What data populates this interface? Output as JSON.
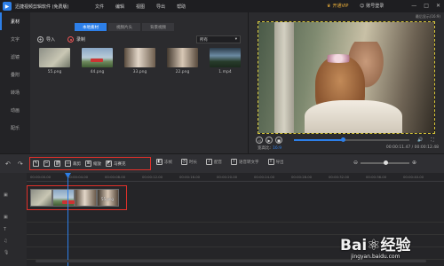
{
  "app": {
    "title": "迅捷视频剪辑软件 (免费版)",
    "menu": [
      "文件",
      "编辑",
      "视图",
      "导出",
      "帮助"
    ],
    "vip_label": "开通VIP",
    "login_label": "账号登录",
    "window_buttons": [
      "—",
      "□",
      "✕"
    ]
  },
  "sidebar": {
    "items": [
      {
        "label": "素材",
        "active": true
      },
      {
        "label": "文字"
      },
      {
        "label": "滤镜"
      },
      {
        "label": "叠附"
      },
      {
        "label": "转场"
      },
      {
        "label": "动画"
      },
      {
        "label": "配乐"
      }
    ]
  },
  "media": {
    "tabs": [
      {
        "label": "本地素材",
        "active": true
      },
      {
        "label": "视频片头"
      },
      {
        "label": "背景视频"
      }
    ],
    "import_label": "导入",
    "record_label": "录制",
    "filter_value": "所有",
    "files": [
      {
        "name": "55.png",
        "thumb": "t1"
      },
      {
        "name": "44.png",
        "thumb": "t2"
      },
      {
        "name": "33.png",
        "thumb": "t3"
      },
      {
        "name": "22.png",
        "thumb": "t4"
      },
      {
        "name": "1.mp4",
        "thumb": "t5"
      }
    ]
  },
  "preview": {
    "top_label": "最后显示(16:9)",
    "ratio_label": "宽高比:",
    "ratio_value": "16:9",
    "time": "00:00:11.47 / 00:00:12.48",
    "progress": 0.43
  },
  "toolbar": {
    "highlighted": [
      {
        "icon": "✎",
        "label": ""
      },
      {
        "icon": "✂",
        "label": ""
      },
      {
        "icon": "🗑",
        "label": ""
      },
      {
        "icon": "▭",
        "label": "裁剪"
      },
      {
        "icon": "⊞",
        "label": "缩放"
      },
      {
        "icon": "◩",
        "label": "马赛克"
      }
    ],
    "rest": [
      {
        "icon": "◧",
        "label": "冻帧"
      },
      {
        "icon": "◷",
        "label": "时长"
      },
      {
        "icon": "♪",
        "label": "配音"
      },
      {
        "icon": "T",
        "label": "语音转文字"
      },
      {
        "icon": "⇪",
        "label": "导出"
      }
    ]
  },
  "timeline": {
    "ticks": [
      "00:00:00.00",
      "00:00:04.00",
      "00:00:08.00",
      "00:00:12.00",
      "00:00:16.00",
      "00:00:20.00",
      "00:00:24.00",
      "00:00:28.00",
      "00:00:32.00",
      "00:00:36.00",
      "00:00:40.00"
    ],
    "clips": [
      {
        "name": "",
        "thumb": "t1"
      },
      {
        "name": "",
        "thumb": "t2"
      },
      {
        "name": "",
        "thumb": "t3"
      },
      {
        "name": "55.png",
        "thumb": "t4"
      }
    ],
    "track_icons": [
      "▣",
      "▣",
      "T",
      "♫",
      "🎙"
    ]
  },
  "watermark": {
    "logo": "Bai⚛经验",
    "url": "jingyan.baidu.com"
  },
  "colors": {
    "accent": "#2d7fe8",
    "highlight": "#e0302a",
    "vip": "#f0b23a"
  }
}
